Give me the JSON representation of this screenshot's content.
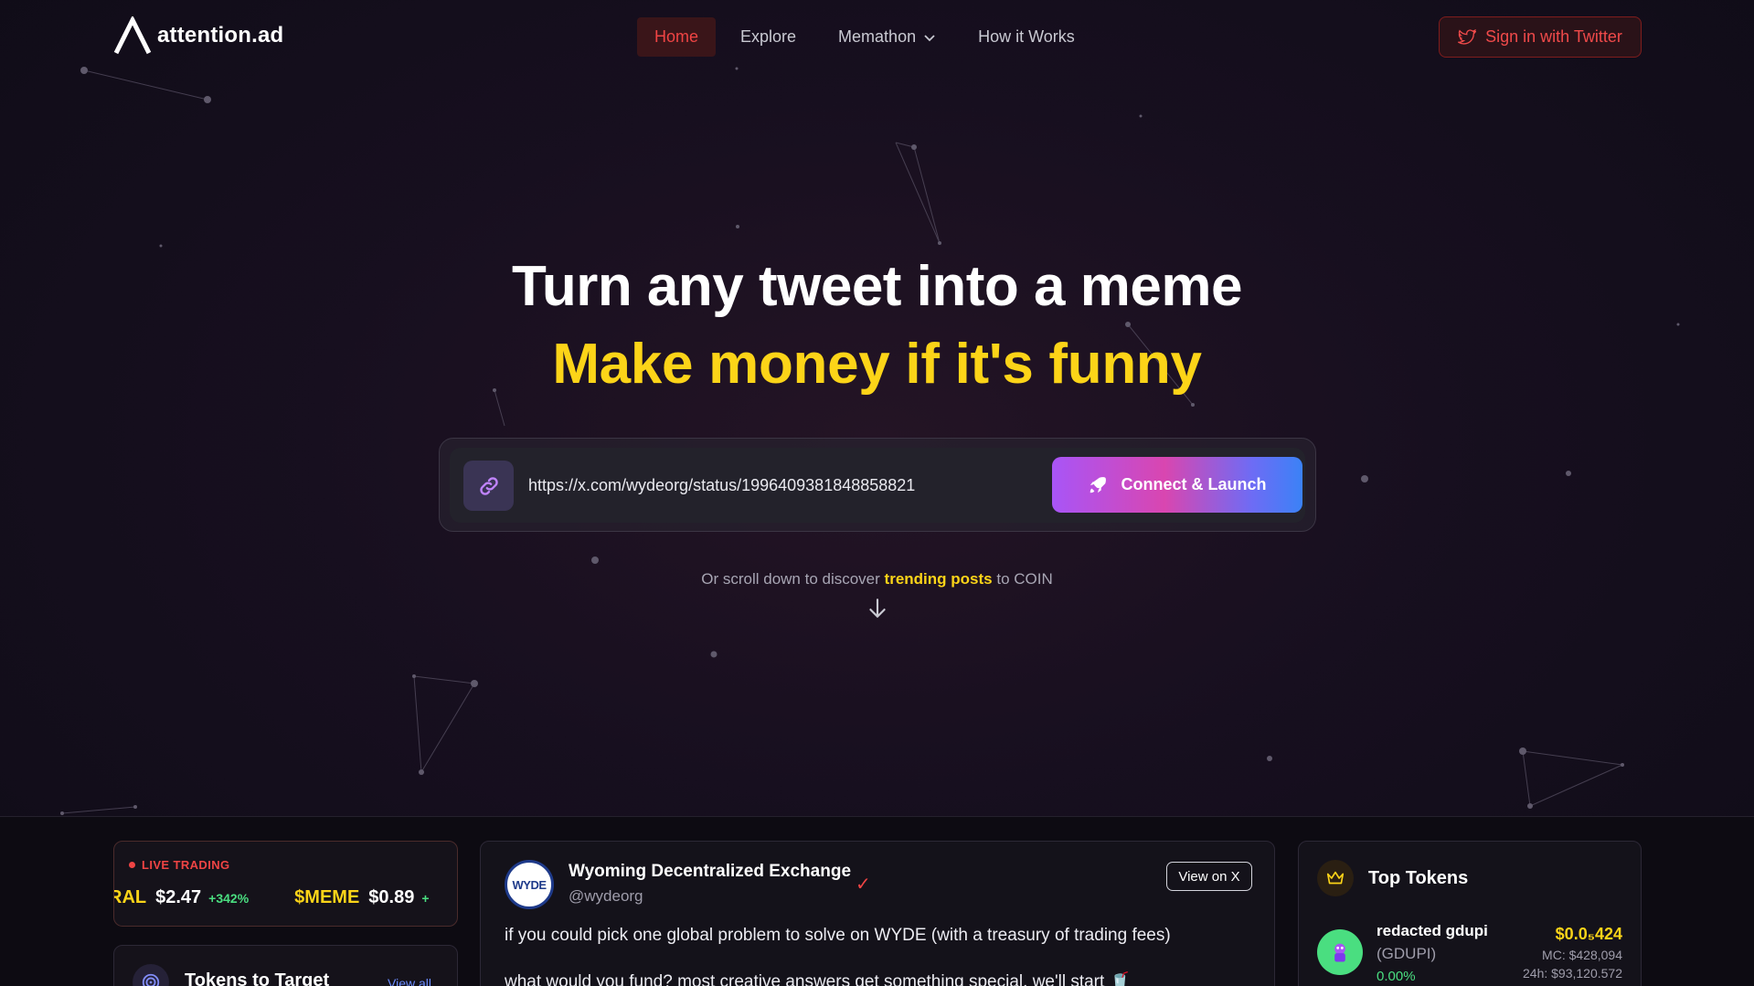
{
  "brand": {
    "name": "attention.ad"
  },
  "nav": {
    "items": [
      {
        "label": "Home",
        "active": true
      },
      {
        "label": "Explore"
      },
      {
        "label": "Memathon",
        "icon": "chevron-down-icon"
      },
      {
        "label": "How it Works"
      }
    ],
    "signin_label": "Sign in with Twitter"
  },
  "hero": {
    "title": "Turn any tweet into a meme",
    "subtitle": "Make money if it's funny",
    "input_value": "https://x.com/wydeorg/status/1996409381848858821",
    "launch_label": "Connect & Launch",
    "hint_before": "Or scroll down to discover",
    "hint_highlight": "trending posts",
    "hint_after": "to COIN"
  },
  "ticker": {
    "live_label": "LIVE TRADING",
    "items": [
      {
        "symbol": "RAL",
        "price": "$2.47",
        "change": "+342%"
      },
      {
        "symbol": "$MEME",
        "price": "$0.89",
        "change": "+"
      }
    ]
  },
  "targets": {
    "title": "Tokens to Target",
    "view_all": "View all"
  },
  "tweet": {
    "avatar_text": "WYDE",
    "name": "Wyoming Decentralized Exchange",
    "handle": "@wydeorg",
    "view_label": "View on X",
    "text_line1": "if you could pick one global problem to solve on WYDE (with a treasury of trading fees)",
    "text_line2": "what would you fund? most creative answers get something special. we'll start 🥤"
  },
  "top_tokens": {
    "title": "Top Tokens",
    "items": [
      {
        "name": "redacted gdupi",
        "symbol": "(GDUPI)",
        "change": "0.00%",
        "price": "$0.0₅424",
        "mc": "MC: $428,094",
        "volume": "24h: $93,120.572"
      }
    ]
  },
  "colors": {
    "accent_red": "#ef4444",
    "accent_yellow": "#fcd418",
    "positive": "#4ade80"
  }
}
